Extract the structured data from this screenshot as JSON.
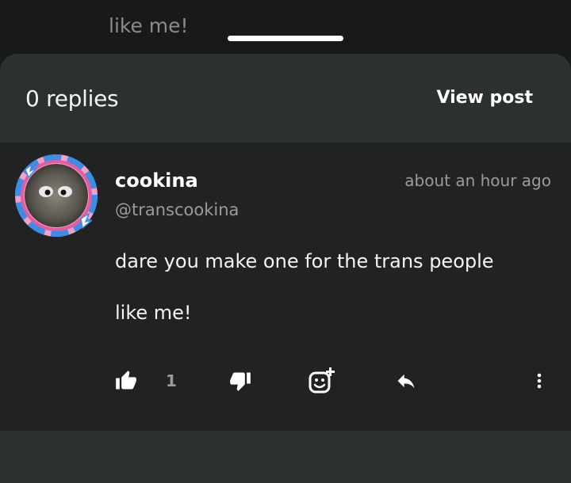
{
  "background": {
    "peek_text": "like me!"
  },
  "sheet": {
    "replies_label": "0 replies",
    "view_post_label": "View post"
  },
  "reply": {
    "username": "cookina",
    "handle": "@transcookina",
    "timestamp": "about an hour ago",
    "body_lines": [
      "dare you make one for the trans people",
      "like me!"
    ],
    "actions": {
      "like_icon": "thumbs-up-icon",
      "like_count": "1",
      "dislike_icon": "thumbs-down-icon",
      "react_icon": "add-emoji-icon",
      "reply_icon": "reply-arrow-icon",
      "more_icon": "more-vertical-icon"
    }
  },
  "colors": {
    "page_bg": "#181a1a",
    "sheet_bg": "#2a2c2c",
    "reply_bg": "#212323",
    "muted_text": "#9a9c9c",
    "avatar_ring_blue": "#3b8ee8",
    "avatar_ring_pink": "#e85aa0"
  }
}
